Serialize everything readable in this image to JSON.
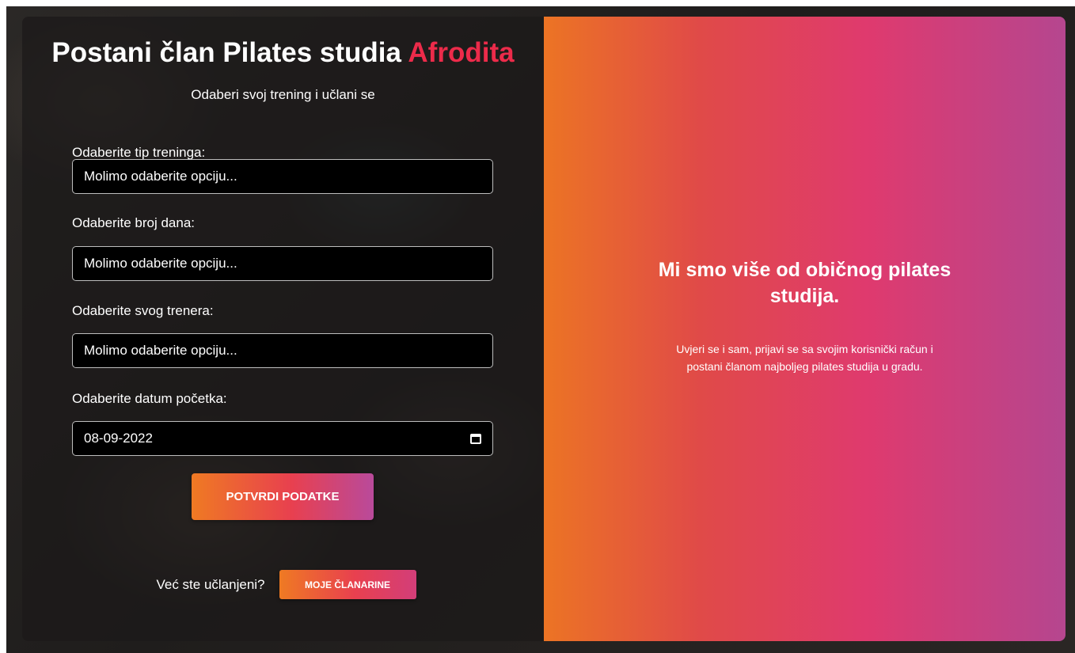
{
  "form": {
    "title_main": "Postani član Pilates studia",
    "title_accent": "Afrodita",
    "subtitle": "Odaberi svoj trening i učlani se",
    "fields": [
      {
        "label": "Odaberite tip treninga:",
        "value": "Molimo odaberite opciju..."
      },
      {
        "label": "Odaberite broj dana:",
        "value": "Molimo odaberite opciju..."
      },
      {
        "label": "Odaberite svog trenera:",
        "value": "Molimo odaberite opciju..."
      },
      {
        "label": "Odaberite datum početka:",
        "value": "08-09-2022"
      }
    ],
    "confirm_label": "POTVRDI PODATKE",
    "member_question": "Već ste učlanjeni?",
    "memberships_label": "MOJE ČLANARINE"
  },
  "hero": {
    "title": "Mi smo više od običnog pilates studija.",
    "text": "Uvjeri se i sam, prijavi se sa svojim korisnički račun i postani članom najboljeg pilates studija u gradu."
  },
  "colors": {
    "accent": "#ec2b4a",
    "gradient_start": "#ec7424",
    "gradient_mid": "#df3a6e",
    "gradient_end": "#b5468f"
  },
  "icons": {
    "date_picker": "calendar-icon"
  }
}
